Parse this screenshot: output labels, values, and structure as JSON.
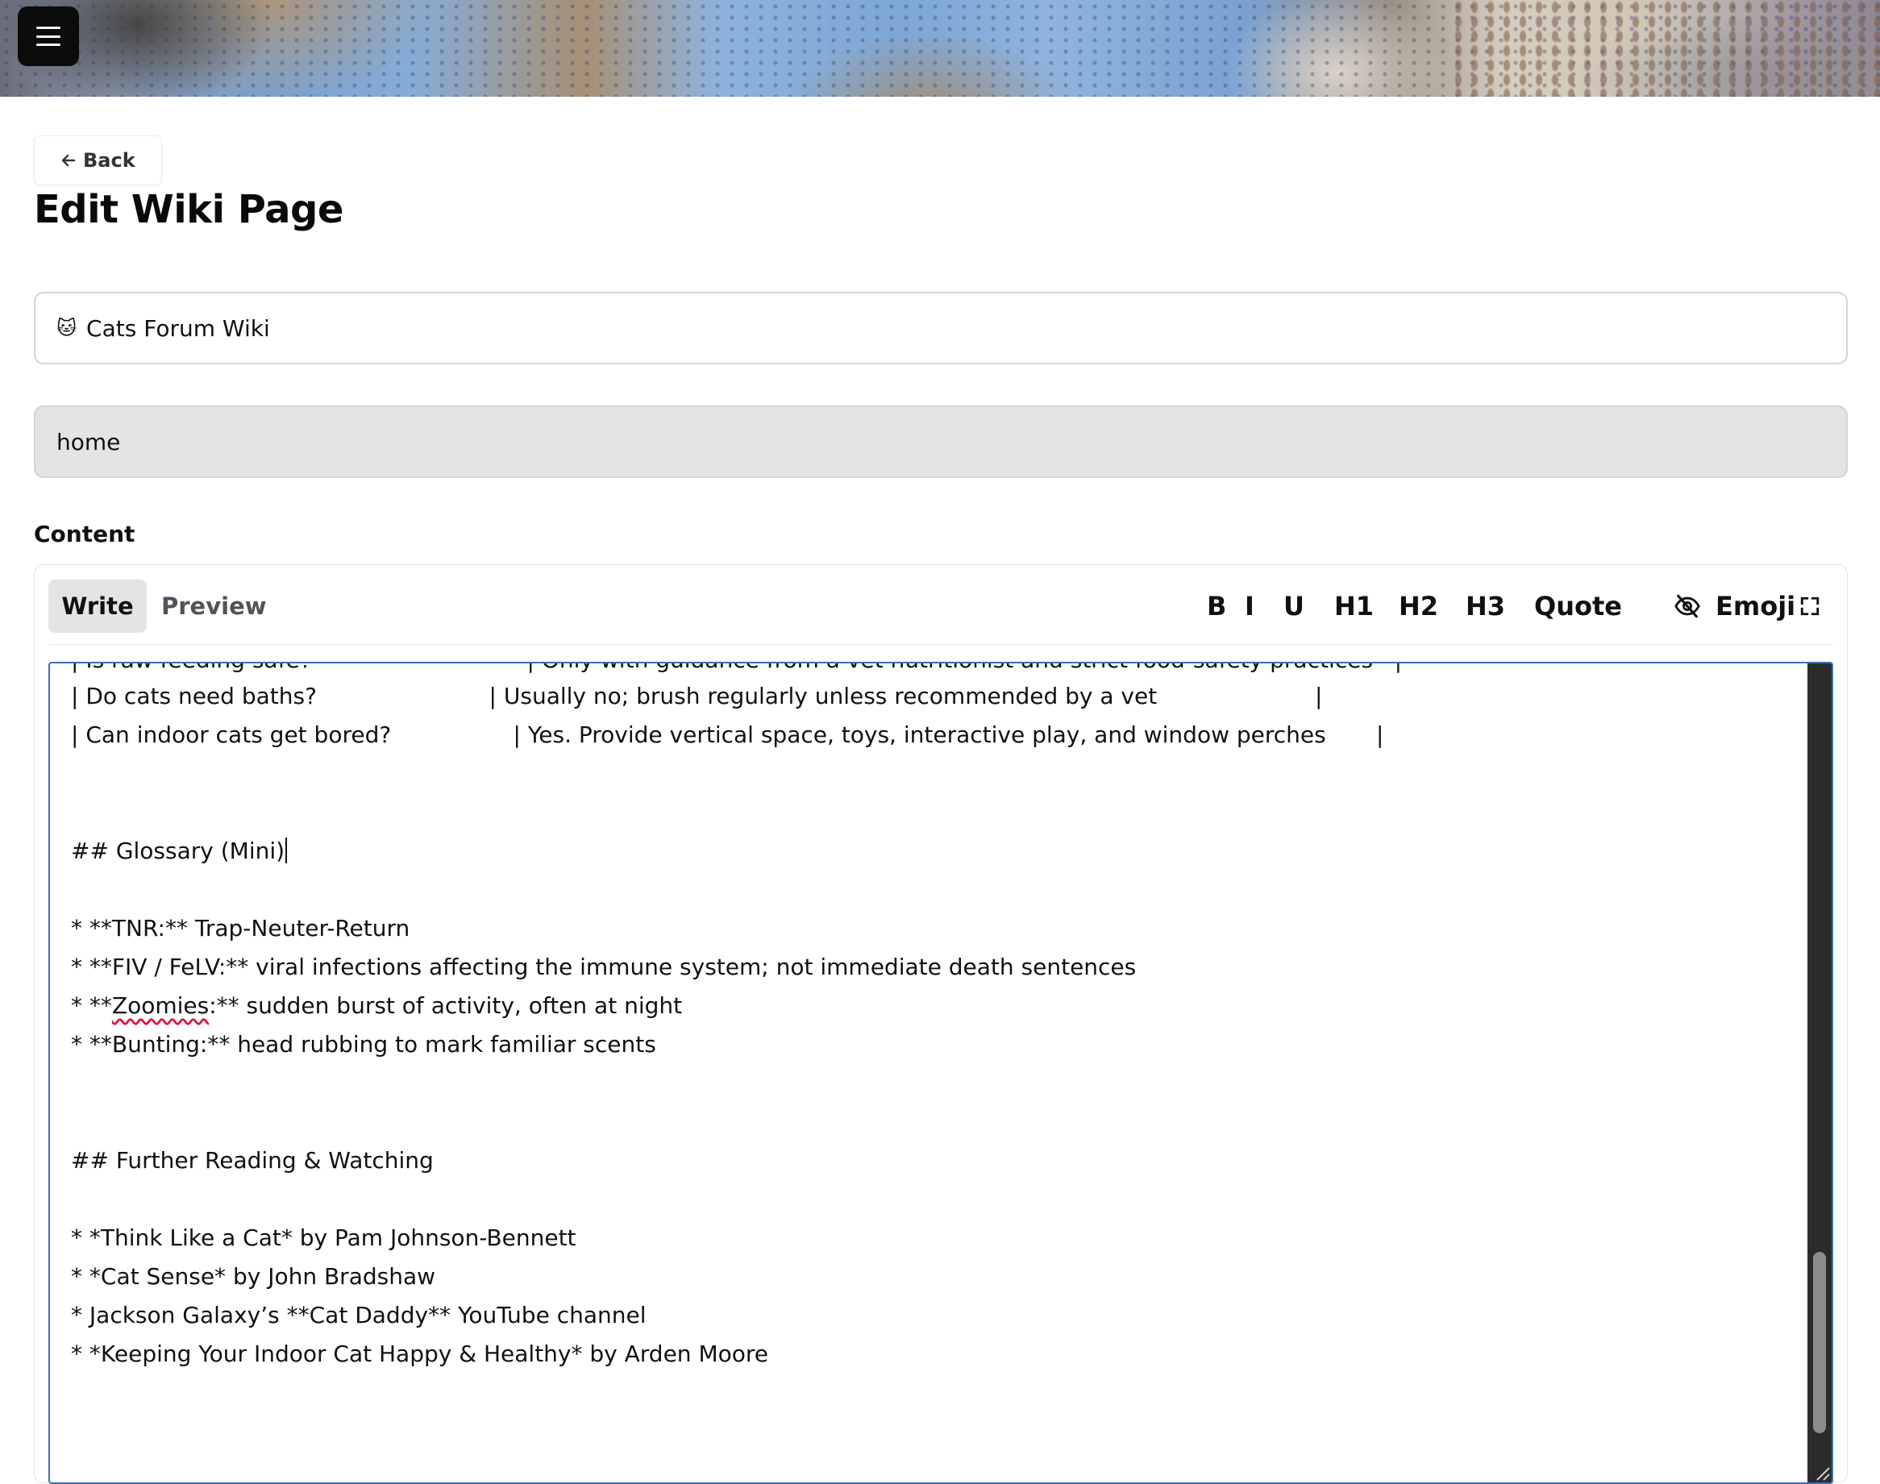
{
  "nav": {
    "menu_icon": "hamburger-icon"
  },
  "back": {
    "icon": "arrow-left-icon",
    "label": "Back"
  },
  "page": {
    "title": "Edit Wiki Page"
  },
  "wiki_field": {
    "emoji": "🐱",
    "value": "Cats Forum Wiki"
  },
  "slug_field": {
    "value": "home"
  },
  "content": {
    "label": "Content",
    "tabs": {
      "write": "Write",
      "preview": "Preview"
    },
    "toolbar": {
      "bold": "B",
      "italic": "I",
      "underline": "U",
      "h1": "H1",
      "h2": "H2",
      "h3": "H3",
      "quote": "Quote",
      "hide_preview_icon": "eye-off-icon",
      "emoji": "Emoji",
      "fullscreen_icon": "fullscreen-icon"
    },
    "lines": {
      "faq_partial": "| Is raw feeding safe?                              | Only with guidance from a vet nutritionist and strict food-safety practices   |",
      "faq_baths": "| Do cats need baths?                        | Usually no; brush regularly unless recommended by a vet                      |",
      "faq_bored": "| Can indoor cats get bored?                 | Yes. Provide vertical space, toys, interactive play, and window perches       |",
      "glossary_heading": "## Glossary (Mini)",
      "glossary_tnr": "* **TNR:** Trap-Neuter-Return",
      "glossary_fiv": "* **FIV / FeLV:** viral infections affecting the immune system; not immediate death sentences",
      "glossary_zoomies_prefix": "* **",
      "glossary_zoomies_word": "Zoomies",
      "glossary_zoomies_rest": ":** sudden burst of activity, often at night",
      "glossary_bunting": "* **Bunting:** head rubbing to mark familiar scents",
      "reading_heading": "## Further Reading & Watching",
      "reading_1": "* *Think Like a Cat* by Pam Johnson-Bennett",
      "reading_2": "* *Cat Sense* by John Bradshaw",
      "reading_3": "* Jackson Galaxy’s **Cat Daddy** YouTube channel",
      "reading_4": "* *Keeping Your Indoor Cat Happy & Healthy* by Arden Moore"
    }
  }
}
